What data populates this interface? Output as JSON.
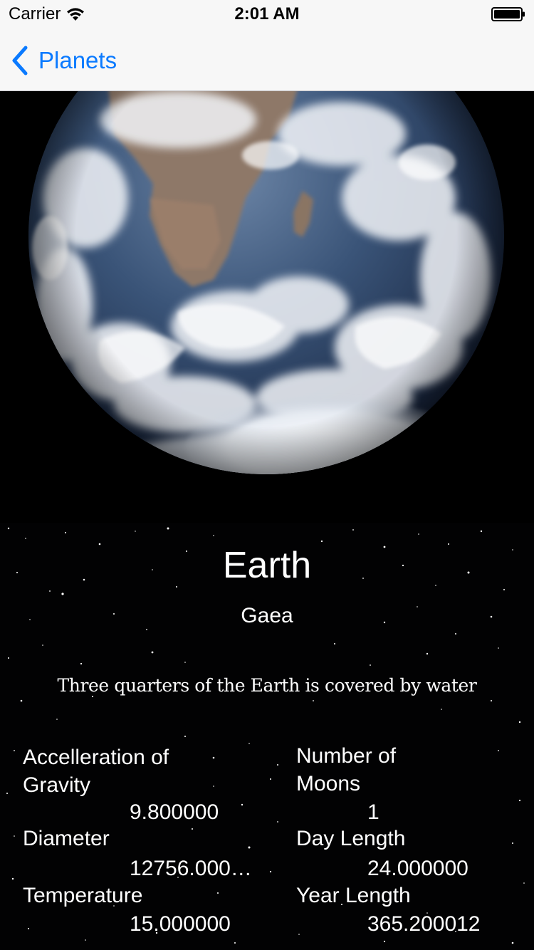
{
  "status_bar": {
    "carrier": "Carrier",
    "time": "2:01 AM"
  },
  "nav": {
    "back_label": "Planets",
    "accent_color": "#0a7aff"
  },
  "planet": {
    "name": "Earth",
    "alt_name": "Gaea",
    "fact": "Three quarters of the Earth is covered by water",
    "image": "earth-photo"
  },
  "stats": {
    "gravity": {
      "label": "Accelleration of Gravity",
      "value": "9.800000"
    },
    "moons": {
      "label": "Number of Moons",
      "value": "1"
    },
    "diameter": {
      "label": "Diameter",
      "value": "12756.000…"
    },
    "day_length": {
      "label": "Day Length",
      "value": "24.000000"
    },
    "temperature": {
      "label": "Temperature",
      "value": "15.000000"
    },
    "year_length": {
      "label": "Year Length",
      "value": "365.200012"
    }
  }
}
